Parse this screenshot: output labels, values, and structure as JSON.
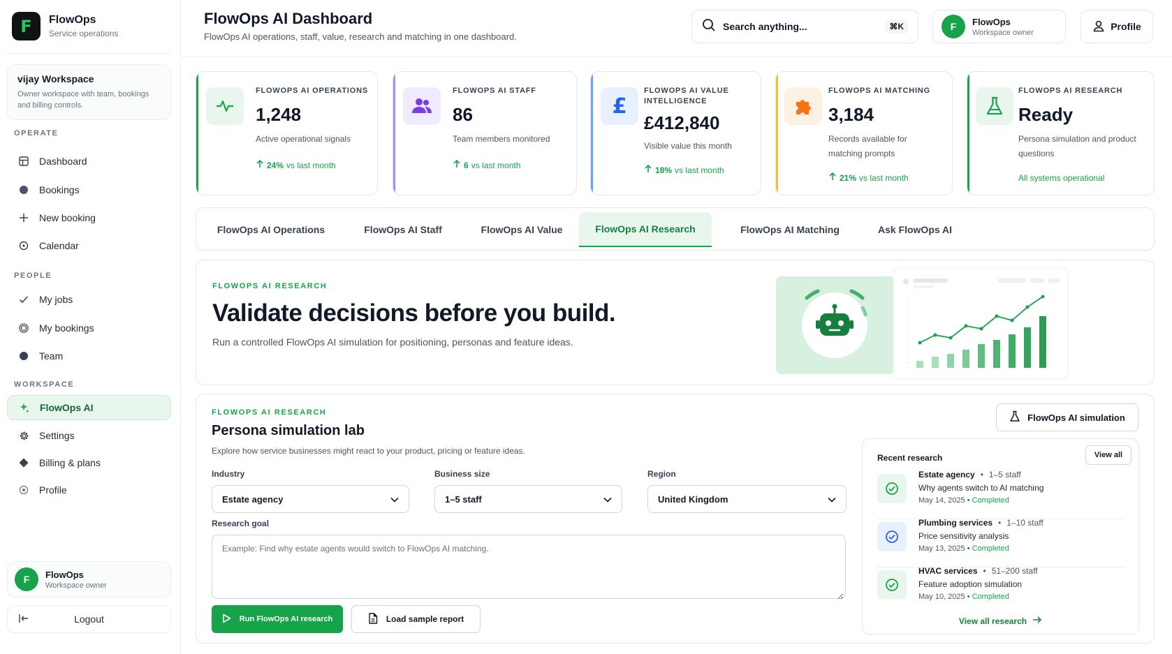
{
  "brand": {
    "name": "FlowOps",
    "sub": "Service operations",
    "logo_letter": "F"
  },
  "workspace": {
    "title": "vijay Workspace",
    "desc": "Owner workspace with team, bookings and billing controls."
  },
  "sidebar": {
    "sections": {
      "operate": "OPERATE",
      "people": "PEOPLE",
      "workspace": "WORKSPACE"
    },
    "items": [
      {
        "label": "Dashboard",
        "icon": "grid-icon"
      },
      {
        "label": "Bookings",
        "icon": "circle-icon"
      },
      {
        "label": "New booking",
        "icon": "plus-icon"
      },
      {
        "label": "Calendar",
        "icon": "target-icon"
      },
      {
        "label": "My jobs",
        "icon": "check-icon"
      },
      {
        "label": "My bookings",
        "icon": "ring-icon"
      },
      {
        "label": "Team",
        "icon": "circle-icon"
      },
      {
        "label": "FlowOps AI",
        "icon": "sparkle-icon",
        "active": true
      },
      {
        "label": "Settings",
        "icon": "gear-icon"
      },
      {
        "label": "Billing & plans",
        "icon": "diamond-icon"
      },
      {
        "label": "Profile",
        "icon": "target-icon"
      }
    ]
  },
  "user": {
    "name": "FlowOps",
    "role": "Workspace owner",
    "initial": "F"
  },
  "logout_label": "Logout",
  "header": {
    "title": "FlowOps AI Dashboard",
    "subtitle": "FlowOps AI operations, staff, value, research and matching in one dashboard.",
    "search_placeholder": "Search anything...",
    "search_shortcut": "⌘K",
    "account_name": "FlowOps",
    "account_role": "Workspace owner",
    "profile_label": "Profile"
  },
  "stats": [
    {
      "label": "FLOWOPS AI OPERATIONS",
      "value": "1,248",
      "desc": "Active operational signals",
      "trend_value": "24%",
      "trend_text": "vs last month",
      "color": "#16a34a"
    },
    {
      "label": "FLOWOPS AI STAFF",
      "value": "86",
      "desc": "Team members monitored",
      "trend_value": "6",
      "trend_text": "vs last month",
      "color": "#8b5cf6"
    },
    {
      "label": "FLOWOPS AI VALUE INTELLIGENCE",
      "value": "£412,840",
      "desc": "Visible value this month",
      "trend_value": "18%",
      "trend_text": "vs last month",
      "color": "#3b82f6"
    },
    {
      "label": "FLOWOPS AI MATCHING",
      "value": "3,184",
      "desc": "Records available for matching prompts",
      "trend_value": "21%",
      "trend_text": "vs last month",
      "color": "#f59e0b"
    },
    {
      "label": "FLOWOPS AI RESEARCH",
      "value": "Ready",
      "desc": "Persona simulation and product questions",
      "status": "All systems operational",
      "color": "#16a34a"
    }
  ],
  "tabs": [
    {
      "label": "FlowOps AI Operations"
    },
    {
      "label": "FlowOps AI Staff"
    },
    {
      "label": "FlowOps AI Value"
    },
    {
      "label": "FlowOps AI Research",
      "active": true
    },
    {
      "label": "FlowOps AI Matching"
    },
    {
      "label": "Ask FlowOps AI"
    }
  ],
  "hero": {
    "eyebrow": "FLOWOPS AI RESEARCH",
    "title": "Validate decisions before you build.",
    "desc": "Run a controlled FlowOps AI simulation for positioning, personas and feature ideas."
  },
  "lab": {
    "eyebrow": "FLOWOPS AI RESEARCH",
    "title": "Persona simulation lab",
    "desc": "Explore how service businesses might react to your product, pricing or feature ideas.",
    "sim_button": "FlowOps AI simulation",
    "industry_label": "Industry",
    "industry_value": "Estate agency",
    "size_label": "Business size",
    "size_value": "1–5 staff",
    "region_label": "Region",
    "region_value": "United Kingdom",
    "goal_label": "Research goal",
    "goal_placeholder": "Example: Find why estate agents would switch to FlowOps AI matching.",
    "run_button": "Run FlowOps AI research",
    "load_button": "Load sample report"
  },
  "recent": {
    "title": "Recent research",
    "view_all": "View all",
    "view_all_link": "View all research",
    "items": [
      {
        "industry": "Estate agency",
        "size": "1–5 staff",
        "topic": "Why agents switch to AI matching",
        "date": "May 14, 2025",
        "status": "Completed",
        "icon_color": "#16a34a"
      },
      {
        "industry": "Plumbing services",
        "size": "1–10 staff",
        "topic": "Price sensitivity analysis",
        "date": "May 13, 2025",
        "status": "Completed",
        "icon_color": "#3b82f6"
      },
      {
        "industry": "HVAC services",
        "size": "51–200 staff",
        "topic": "Feature adoption simulation",
        "date": "May 10, 2025",
        "status": "Completed",
        "icon_color": "#16a34a"
      }
    ]
  },
  "colors": {
    "accent": "#16a34a",
    "accent_light": "#e9f6ee"
  }
}
